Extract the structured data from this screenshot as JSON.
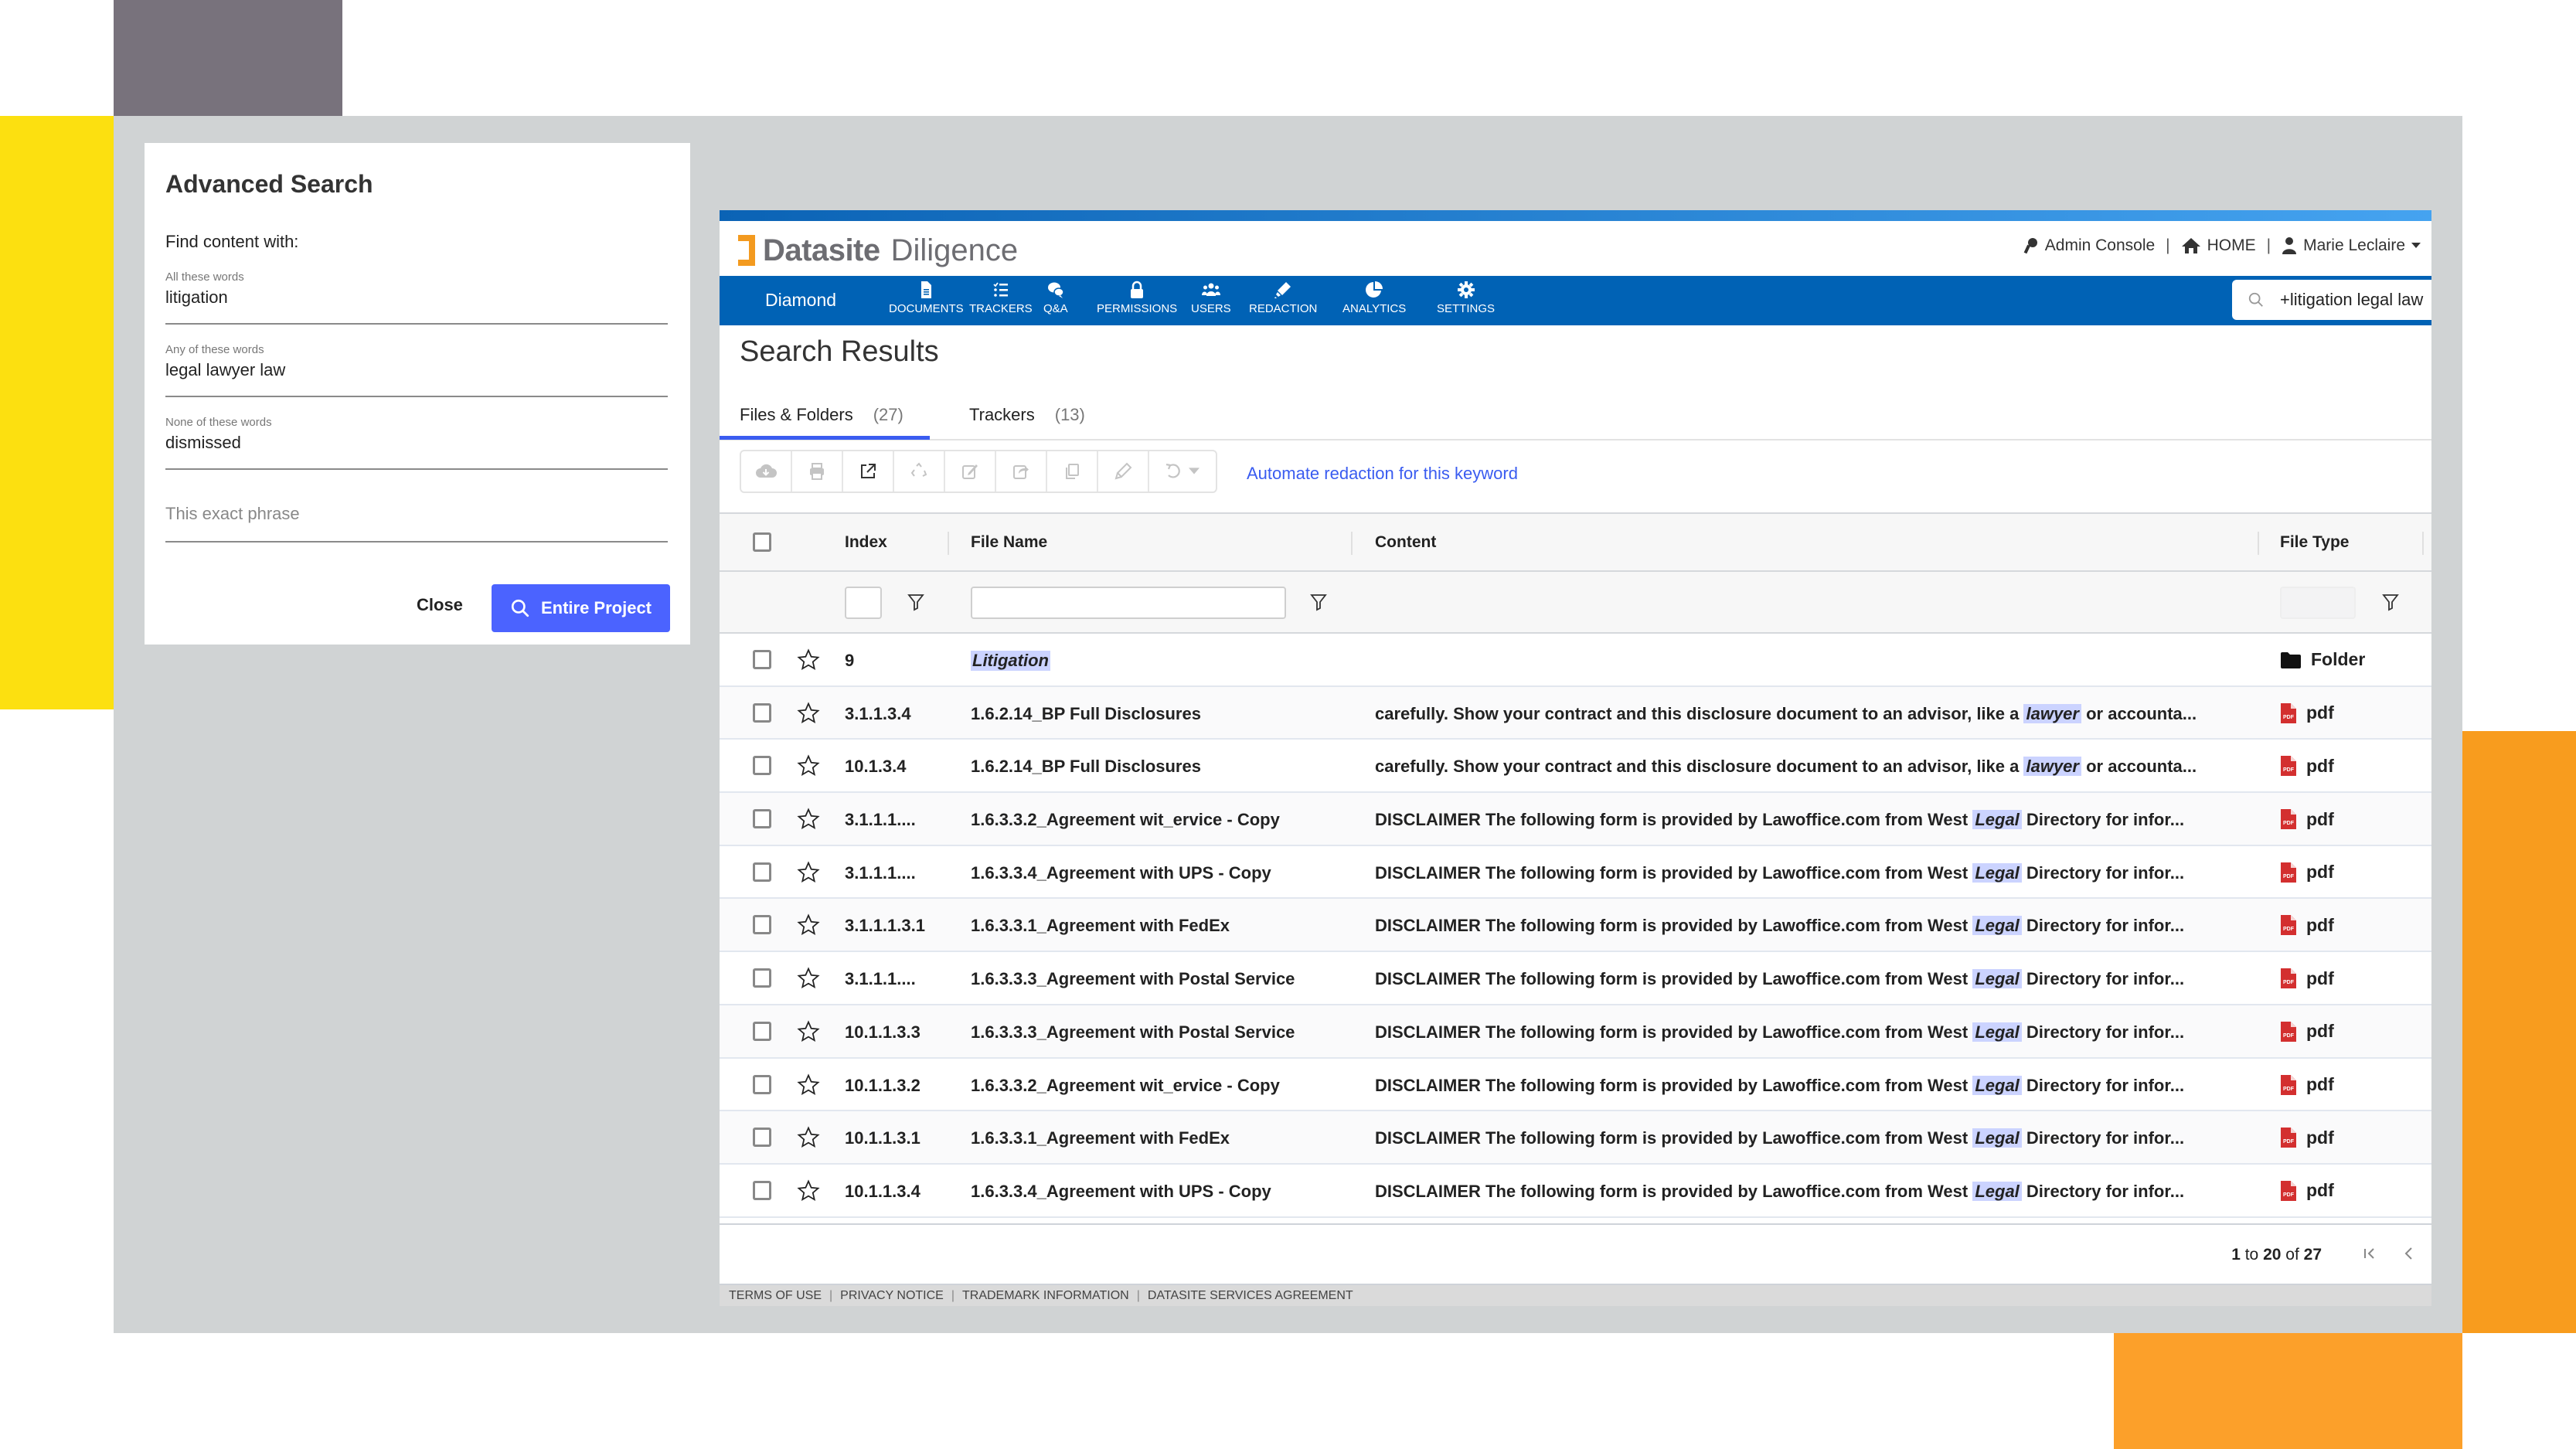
{
  "advanced_search": {
    "title": "Advanced Search",
    "find_label": "Find content with:",
    "fields": [
      {
        "label": "All these words",
        "value": "litigation",
        "placeholder": ""
      },
      {
        "label": "Any of these words",
        "value": "legal lawyer law",
        "placeholder": ""
      },
      {
        "label": "None of these words",
        "value": "dismissed",
        "placeholder": ""
      },
      {
        "label": "",
        "value": "",
        "placeholder": "This exact phrase"
      }
    ],
    "close_label": "Close",
    "search_label": "Entire Project"
  },
  "header": {
    "brand": "Datasite",
    "product": "Diligence",
    "admin_console": "Admin Console",
    "home": "HOME",
    "user": "Marie Leclaire",
    "project": "Diamond",
    "nav": [
      {
        "label": "DOCUMENTS",
        "icon": "document-icon"
      },
      {
        "label": "TRACKERS",
        "icon": "checklist-icon"
      },
      {
        "label": "Q&A",
        "icon": "chat-icon"
      },
      {
        "label": "PERMISSIONS",
        "icon": "lock-icon"
      },
      {
        "label": "USERS",
        "icon": "users-icon"
      },
      {
        "label": "REDACTION",
        "icon": "marker-icon"
      },
      {
        "label": "ANALYTICS",
        "icon": "pie-chart-icon"
      },
      {
        "label": "SETTINGS",
        "icon": "gear-icon"
      }
    ],
    "search_value": "+litigation legal law"
  },
  "page": {
    "title": "Search Results",
    "tabs": [
      {
        "label": "Files & Folders",
        "count": "(27)",
        "active": true
      },
      {
        "label": "Trackers",
        "count": "(13)",
        "active": false
      }
    ],
    "toolbar": [
      "download-icon",
      "print-icon",
      "open-external-icon",
      "recycle-icon",
      "edit-icon",
      "share-icon",
      "copy-icon",
      "redact-icon",
      "undo-icon"
    ],
    "automate_link": "Automate redaction for this keyword"
  },
  "table": {
    "columns": [
      "Index",
      "File Name",
      "Content",
      "File Type"
    ],
    "rows": [
      {
        "index": "9",
        "name": "Litigation",
        "name_highlight": true,
        "content_pre": "",
        "content_hl": "",
        "content_post": "",
        "type": "Folder",
        "type_icon": "folder"
      },
      {
        "index": "3.1.1.3.4",
        "name": "1.6.2.14_BP Full Disclosures",
        "content_pre": "carefully. Show your contract and this disclosure document to an advisor, like a ",
        "content_hl": "lawyer",
        "content_post": " or accounta...",
        "type": "pdf",
        "type_icon": "pdf"
      },
      {
        "index": "10.1.3.4",
        "name": "1.6.2.14_BP Full Disclosures",
        "content_pre": "carefully. Show your contract and this disclosure document to an advisor, like a ",
        "content_hl": "lawyer",
        "content_post": " or accounta...",
        "type": "pdf",
        "type_icon": "pdf"
      },
      {
        "index": "3.1.1.1....",
        "name": "1.6.3.3.2_Agreement wit_ervice - Copy",
        "content_pre": "DISCLAIMER The following form is provided by Lawoffice.com from West ",
        "content_hl": "Legal",
        "content_post": " Directory for infor...",
        "type": "pdf",
        "type_icon": "pdf"
      },
      {
        "index": "3.1.1.1....",
        "name": "1.6.3.3.4_Agreement with UPS - Copy",
        "content_pre": "DISCLAIMER The following form is provided by Lawoffice.com from West ",
        "content_hl": "Legal",
        "content_post": " Directory for infor...",
        "type": "pdf",
        "type_icon": "pdf"
      },
      {
        "index": "3.1.1.1.3.1",
        "name": "1.6.3.3.1_Agreement with FedEx",
        "content_pre": "DISCLAIMER The following form is provided by Lawoffice.com from West ",
        "content_hl": "Legal",
        "content_post": " Directory for infor...",
        "type": "pdf",
        "type_icon": "pdf"
      },
      {
        "index": "3.1.1.1....",
        "name": "1.6.3.3.3_Agreement with Postal Service",
        "content_pre": "DISCLAIMER The following form is provided by Lawoffice.com from West ",
        "content_hl": "Legal",
        "content_post": " Directory for infor...",
        "type": "pdf",
        "type_icon": "pdf"
      },
      {
        "index": "10.1.1.3.3",
        "name": "1.6.3.3.3_Agreement with Postal Service",
        "content_pre": "DISCLAIMER The following form is provided by Lawoffice.com from West ",
        "content_hl": "Legal",
        "content_post": " Directory for infor...",
        "type": "pdf",
        "type_icon": "pdf"
      },
      {
        "index": "10.1.1.3.2",
        "name": "1.6.3.3.2_Agreement wit_ervice - Copy",
        "content_pre": "DISCLAIMER The following form is provided by Lawoffice.com from West ",
        "content_hl": "Legal",
        "content_post": " Directory for infor...",
        "type": "pdf",
        "type_icon": "pdf"
      },
      {
        "index": "10.1.1.3.1",
        "name": "1.6.3.3.1_Agreement with FedEx",
        "content_pre": "DISCLAIMER The following form is provided by Lawoffice.com from West ",
        "content_hl": "Legal",
        "content_post": " Directory for infor...",
        "type": "pdf",
        "type_icon": "pdf"
      },
      {
        "index": "10.1.1.3.4",
        "name": "1.6.3.3.4_Agreement with UPS - Copy",
        "content_pre": "DISCLAIMER The following form is provided by Lawoffice.com from West ",
        "content_hl": "Legal",
        "content_post": " Directory for infor...",
        "type": "pdf",
        "type_icon": "pdf"
      }
    ]
  },
  "pagination": {
    "from": "1",
    "to_word": "to",
    "to": "20",
    "of_word": "of",
    "total": "27"
  },
  "footer": [
    "TERMS OF USE",
    "PRIVACY NOTICE",
    "TRADEMARK INFORMATION",
    "DATASITE SERVICES AGREEMENT"
  ],
  "colors": {
    "nav_blue": "#0062b5",
    "accent": "#4b63ff",
    "highlight": "#cbd3ff",
    "pdf_red": "#d32f2f",
    "logo_orange": "#f39a1f"
  }
}
